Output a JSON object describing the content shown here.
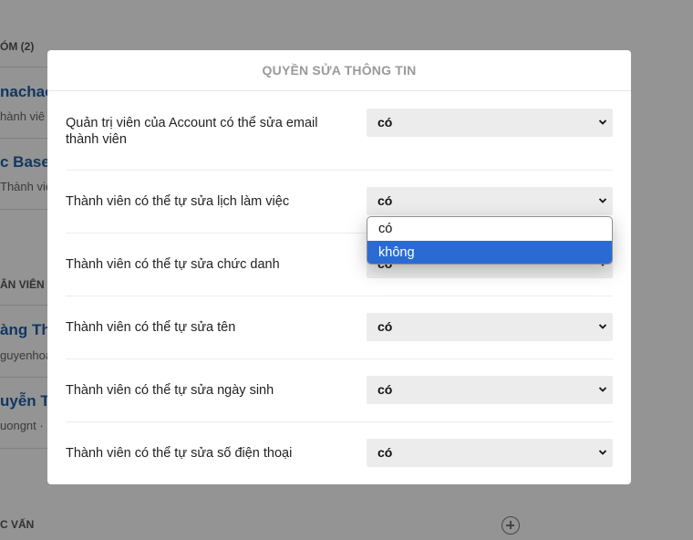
{
  "background": {
    "section1": "ÓM (2)",
    "items1": [
      {
        "title": "nachao",
        "subtitle": "hành viê"
      },
      {
        "title": "c Base",
        "subtitle": "Thành viê"
      }
    ],
    "section2": "ÂN VIÊN T",
    "items2": [
      {
        "title": "àng Th",
        "subtitle": "guyenhoa"
      },
      {
        "title": "uyễn T",
        "subtitle": "uongnt ·"
      }
    ],
    "section3": "C VẤN"
  },
  "modal": {
    "title": "QUYỀN SỬA THÔNG TIN",
    "rows": [
      {
        "label": "Quản trị viên của Account có thể sửa email thành viên",
        "value": "có"
      },
      {
        "label": "Thành viên có thể tự sửa lịch làm việc",
        "value": "có"
      },
      {
        "label": "Thành viên có thể tự sửa chức danh",
        "value": "có"
      },
      {
        "label": "Thành viên có thể tự sửa tên",
        "value": "có"
      },
      {
        "label": "Thành viên có thể tự sửa ngày sinh",
        "value": "có"
      },
      {
        "label": "Thành viên có thể tự sửa số điện thoại",
        "value": "có"
      }
    ]
  },
  "dropdown": {
    "options": [
      "có",
      "không"
    ],
    "highlighted": "không"
  },
  "icons": {
    "select_arrow": "chevron-down-icon",
    "add": "plus-circle-icon"
  }
}
